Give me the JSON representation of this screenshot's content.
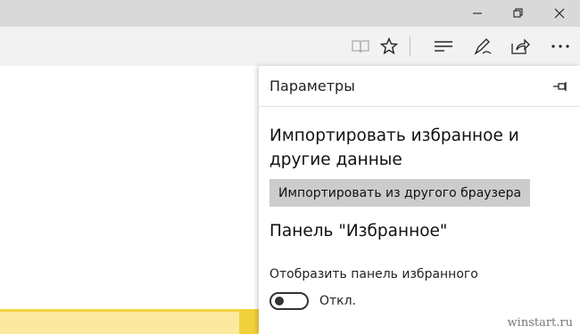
{
  "window": {
    "minimize_icon": "minimize-icon",
    "restore_icon": "restore-icon",
    "close_icon": "close-icon"
  },
  "toolbar": {
    "icons": [
      "reading-view-icon",
      "favorite-star-icon",
      "hub-icon",
      "web-note-icon",
      "share-icon",
      "more-icon"
    ]
  },
  "settings": {
    "title": "Параметры",
    "import_heading": "Импортировать избранное и другие данные",
    "import_button": "Импортировать из другого браузера",
    "favorites_bar_heading": "Панель \"Избранное\"",
    "show_favorites_bar_label": "Отобразить панель избранного",
    "toggle_state": "Откл."
  },
  "watermark": "winstart.ru",
  "colors": {
    "titlebar": "#d9d9d9",
    "toolbar": "#f2f2f2",
    "button": "#cccccc",
    "yellow": "#f3d13d"
  }
}
